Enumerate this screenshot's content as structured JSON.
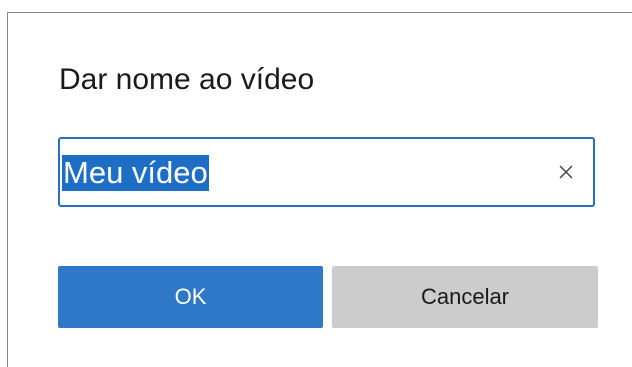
{
  "dialog": {
    "title": "Dar nome ao vídeo",
    "input": {
      "value": "Meu vídeo",
      "value_selected": true,
      "clear_icon": "close-icon"
    },
    "buttons": {
      "ok_label": "OK",
      "cancel_label": "Cancelar"
    }
  },
  "colors": {
    "accent": "#2f78c8",
    "selection": "#1e6ec6",
    "field_border": "#2a70c0",
    "secondary_button": "#cccccc"
  }
}
